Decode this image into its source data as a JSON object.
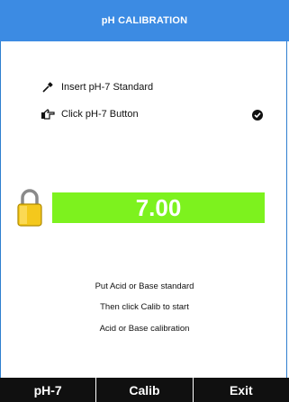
{
  "header": {
    "title": "pH CALIBRATION"
  },
  "steps": [
    {
      "icon": "dropper-icon",
      "label": "Insert pH-7 Standard"
    },
    {
      "icon": "pointing-hand-icon",
      "label": "Click pH-7 Button",
      "completed": true
    }
  ],
  "reading": {
    "value": "7.00",
    "locked": true,
    "bar_color": "#7df21e"
  },
  "instructions": [
    "Put Acid or Base standard",
    "Then click Calib to start",
    "Acid or Base calibration"
  ],
  "softkeys": [
    {
      "label": "pH-7"
    },
    {
      "label": "Calib"
    },
    {
      "label": "Exit"
    }
  ],
  "colors": {
    "header": "#3c8be3",
    "softkey_bar": "#101010"
  }
}
